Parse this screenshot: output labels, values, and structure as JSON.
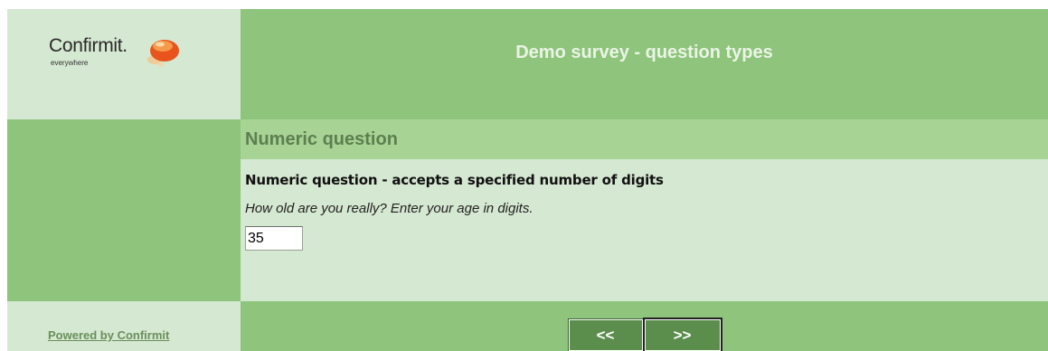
{
  "logo": {
    "wordmark": "Confirmit.",
    "tagline": "everywhere"
  },
  "header": {
    "title": "Demo survey - question types"
  },
  "section": {
    "title": "Numeric question"
  },
  "question": {
    "title": "Numeric question - accepts a specified number of digits",
    "text": "How old are you really? Enter your age in digits.",
    "answer_value": "35"
  },
  "footer": {
    "powered_by": "Powered by Confirmit",
    "back_label": "<<",
    "next_label": ">>"
  },
  "colors": {
    "dark_green": "#8ec47c",
    "light_green": "#d5e8d1",
    "section_green": "#a7d394",
    "button_green": "#5b8d4d"
  }
}
